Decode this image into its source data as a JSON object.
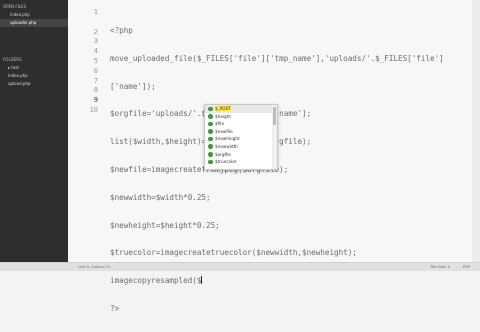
{
  "sidebar": {
    "open_files_label": "OPEN FILES",
    "open_files": [
      {
        "label": "index.php"
      },
      {
        "label": "uploader.php"
      }
    ],
    "folders_label": "FOLDERS",
    "folder_items": [
      {
        "label": "▸ test"
      },
      {
        "label": "index.php"
      },
      {
        "label": "upload.php"
      }
    ]
  },
  "editor": {
    "line_numbers": [
      "1",
      "",
      "2",
      "3",
      "4",
      "5",
      "6",
      "7",
      "8",
      "9",
      "10"
    ],
    "lines": [
      "<?php",
      "move_uploaded_file($_FILES['file']['tmp_name'],'uploads/'.$_FILES['file']",
      "['name']);",
      "$orgfile='uploads/'.$_FILES['file']['name'];",
      "list($width,$height)=getimagesize($orgfile);",
      "$newfile=imagecreatefromjpeg($orgfile);",
      "$newwidth=$width*0.25;",
      "$newheight=$height*0.25;",
      "$truecolor=imagecreatetruecolor($newwidth,$newheight);",
      "imagecopyresampled($",
      "?>"
    ]
  },
  "autocomplete": {
    "items": [
      {
        "label": "$_POST"
      },
      {
        "label": "$height"
      },
      {
        "label": "$file"
      },
      {
        "label": "$newfile"
      },
      {
        "label": "$newheight"
      },
      {
        "label": "$newwidth"
      },
      {
        "label": "$orgfile"
      },
      {
        "label": "$truecolor"
      }
    ]
  },
  "statusbar": {
    "left": "Line 9, Column 21",
    "right": [
      "Tab Size: 4",
      "PHP"
    ]
  }
}
